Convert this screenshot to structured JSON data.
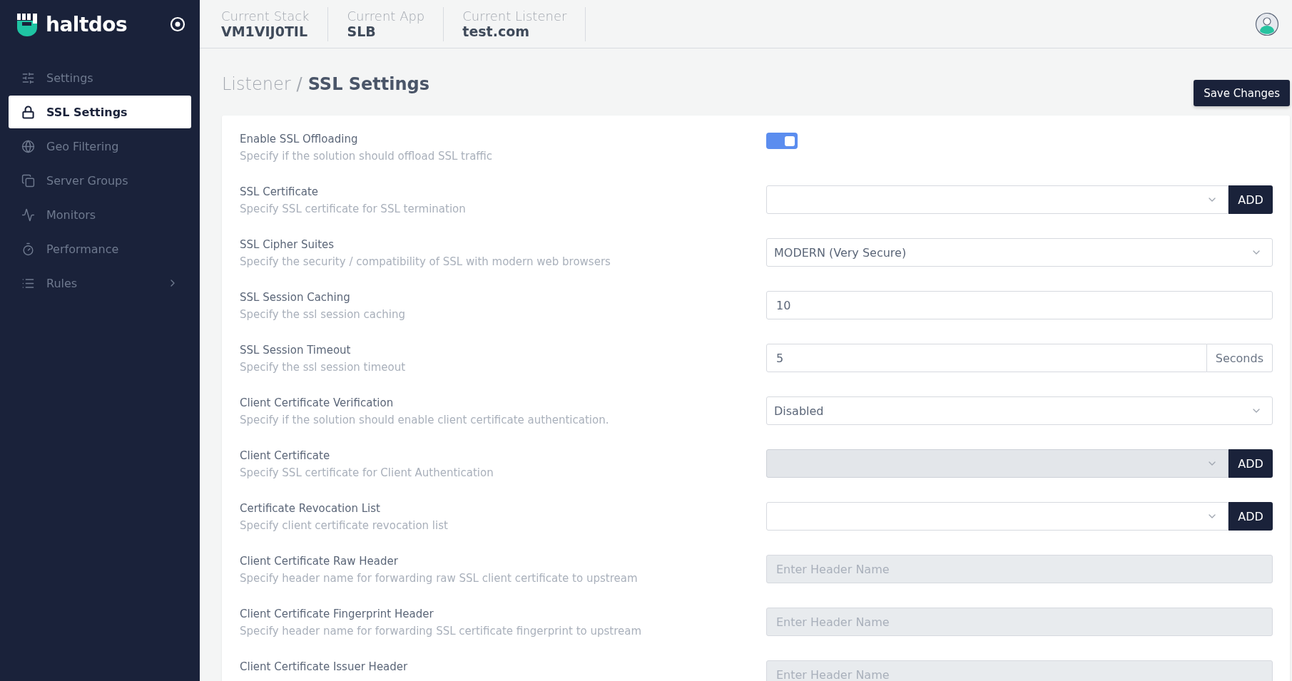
{
  "brand": {
    "name": "haltdos"
  },
  "sidebar": {
    "items": [
      {
        "label": "Settings",
        "selected": false
      },
      {
        "label": "SSL Settings",
        "selected": true
      },
      {
        "label": "Geo Filtering",
        "selected": false
      },
      {
        "label": "Server Groups",
        "selected": false
      },
      {
        "label": "Monitors",
        "selected": false
      },
      {
        "label": "Performance",
        "selected": false
      },
      {
        "label": "Rules",
        "selected": false,
        "expandable": true
      }
    ]
  },
  "header": {
    "contexts": [
      {
        "label": "Current Stack",
        "value": "VM1VIJ0TIL"
      },
      {
        "label": "Current App",
        "value": "SLB"
      },
      {
        "label": "Current Listener",
        "value": "test.com"
      }
    ]
  },
  "breadcrumb": {
    "parent": "Listener",
    "separator": "/",
    "current": "SSL Settings"
  },
  "save_button": "Save Changes",
  "rows": [
    {
      "kind": "toggle",
      "label": "Enable SSL Offloading",
      "description": "Specify if the solution should offload SSL traffic",
      "on": true
    },
    {
      "kind": "select_add",
      "label": "SSL Certificate",
      "description": "Specify SSL certificate for SSL termination",
      "button": "ADD",
      "disabled": false
    },
    {
      "kind": "select",
      "label": "SSL Cipher Suites",
      "description": "Specify the security / compatibility of SSL with modern web browsers",
      "value": "MODERN (Very Secure)"
    },
    {
      "kind": "input",
      "label": "SSL Session Caching",
      "description": "Specify the ssl session caching",
      "value": "10",
      "disabled": false
    },
    {
      "kind": "input_addon",
      "label": "SSL Session Timeout",
      "description": "Specify the ssl session timeout",
      "value": "5",
      "addon": "Seconds"
    },
    {
      "kind": "select",
      "label": "Client Certificate Verification",
      "description": "Specify if the solution should enable client certificate authentication.",
      "value": "Disabled"
    },
    {
      "kind": "select_add",
      "label": "Client Certificate",
      "description": "Specify SSL certificate for Client Authentication",
      "button": "ADD",
      "disabled": true
    },
    {
      "kind": "select_add",
      "label": "Certificate Revocation List",
      "description": "Specify client certificate revocation list",
      "button": "ADD",
      "disabled": false
    },
    {
      "kind": "input",
      "label": "Client Certificate Raw Header",
      "description": "Specify header name for forwarding raw SSL client certificate to upstream",
      "placeholder": "Enter Header Name",
      "disabled": true
    },
    {
      "kind": "input",
      "label": "Client Certificate Fingerprint Header",
      "description": "Specify header name for forwarding SSL certificate fingerprint to upstream",
      "placeholder": "Enter Header Name",
      "disabled": true
    },
    {
      "kind": "input",
      "label": "Client Certificate Issuer Header",
      "placeholder": "Enter Header Name",
      "disabled": true
    }
  ]
}
